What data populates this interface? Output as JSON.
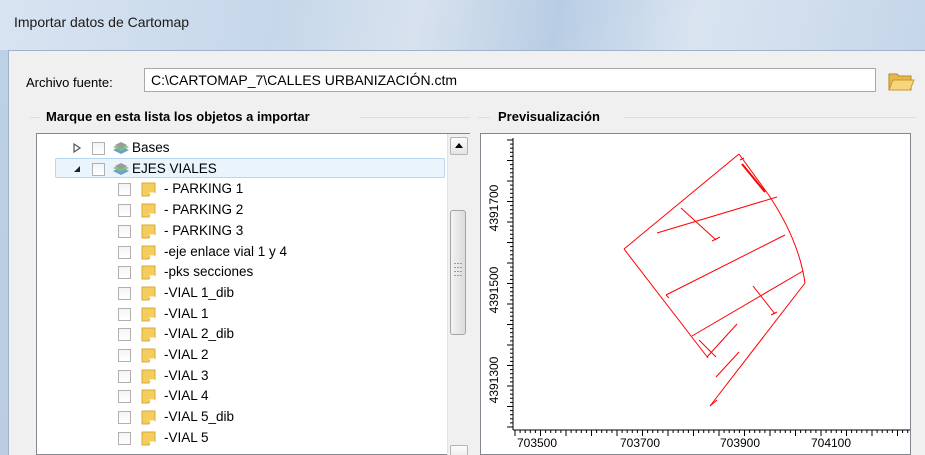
{
  "window": {
    "title": "Importar datos de Cartomap"
  },
  "source": {
    "label": "Archivo fuente:",
    "path": "C:\\CARTOMAP_7\\CALLES URBANIZACIÓN.ctm"
  },
  "objects_group": {
    "title": "Marque en esta lista los objetos a importar"
  },
  "preview_group": {
    "title": "Previsualización"
  },
  "tree": {
    "nodes": [
      {
        "label": "Bases",
        "expander": "collapsed",
        "icon": "layers-icon"
      },
      {
        "label": "EJES VIALES",
        "expander": "expanded",
        "icon": "layers-icon",
        "selected": true
      },
      {
        "label": " - PARKING 1",
        "icon": "layer-icon"
      },
      {
        "label": " - PARKING 2",
        "icon": "layer-icon"
      },
      {
        "label": " - PARKING 3",
        "icon": "layer-icon"
      },
      {
        "label": "-eje enlace vial 1 y 4",
        "icon": "layer-icon"
      },
      {
        "label": "-pks secciones",
        "icon": "layer-icon"
      },
      {
        "label": "-VIAL 1_dib",
        "icon": "layer-icon"
      },
      {
        "label": "-VIAL 1",
        "icon": "layer-icon"
      },
      {
        "label": "-VIAL 2_dib",
        "icon": "layer-icon"
      },
      {
        "label": "-VIAL 2",
        "icon": "layer-icon"
      },
      {
        "label": "-VIAL 3",
        "icon": "layer-icon"
      },
      {
        "label": "-VIAL 4",
        "icon": "layer-icon"
      },
      {
        "label": "-VIAL 5_dib",
        "icon": "layer-icon"
      },
      {
        "label": "-VIAL 5",
        "icon": "layer-icon"
      }
    ]
  },
  "axes": {
    "y_ticks": [
      "4391700",
      "4391500",
      "4391300"
    ],
    "x_ticks": [
      "703500",
      "703700",
      "703900",
      "704100"
    ]
  },
  "colors": {
    "geometry": "#ff0000",
    "selection": "#eaf4fd"
  }
}
